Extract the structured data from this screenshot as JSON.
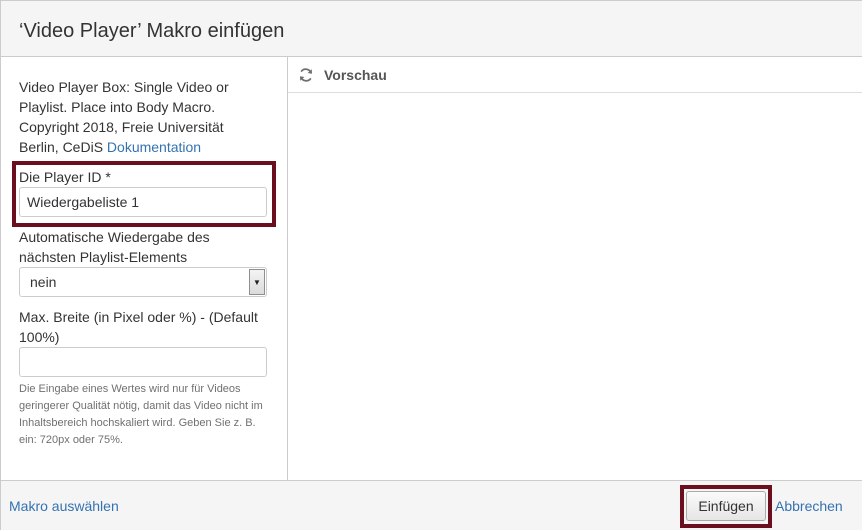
{
  "dialog": {
    "title": "‘Video Player’ Makro einfügen"
  },
  "form": {
    "description": "Video Player Box: Single Video or Playlist. Place into Body Macro. Copyright 2018, Freie Universität Berlin, CeDiS",
    "doc_link": "Dokumentation",
    "player_id": {
      "label": "Die Player ID *",
      "value": "Wiedergabeliste 1"
    },
    "autoplay": {
      "label": "Automatische Wiedergabe des nächsten Playlist-Elements",
      "selected": "nein"
    },
    "max_width": {
      "label": "Max. Breite (in Pixel oder %) - (Default 100%)",
      "value": "",
      "help": "Die Eingabe eines Wertes wird nur für Videos geringerer Qualität nötig, damit das Video nicht im Inhaltsbereich hochskaliert wird. Geben Sie z. B. ein: 720px oder 75%."
    }
  },
  "preview": {
    "title": "Vorschau",
    "icon": "refresh-icon"
  },
  "footer": {
    "select_macro": "Makro auswählen",
    "insert": "Einfügen",
    "cancel": "Abbrechen"
  },
  "colors": {
    "highlight": "#6b0f1f",
    "link": "#3572b0"
  }
}
